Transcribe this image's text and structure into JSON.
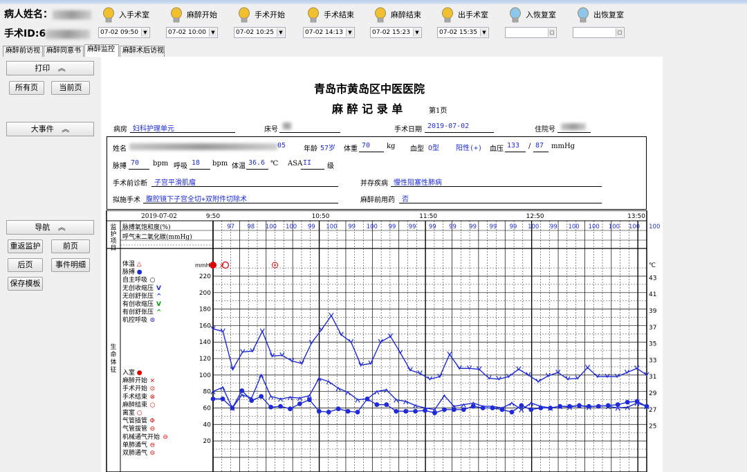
{
  "patient": {
    "name_label": "病人姓名：",
    "surgery_id_label": "手术ID:",
    "surgery_id_partial": "6"
  },
  "events": [
    {
      "label": "入手术室",
      "time": "07-02 09:50",
      "color": "#f0c030"
    },
    {
      "label": "麻醉开始",
      "time": "07-02 10:00",
      "color": "#f0c030"
    },
    {
      "label": "手术开始",
      "time": "07-02 10:25",
      "color": "#f0c030"
    },
    {
      "label": "手术结束",
      "time": "07-02 14:13",
      "color": "#f0c030"
    },
    {
      "label": "麻醉结束",
      "time": "07-02 15:23",
      "color": "#f0c030"
    },
    {
      "label": "出手术室",
      "time": "07-02 15:35",
      "color": "#f0c030"
    },
    {
      "label": "入恢复室",
      "time": "",
      "color": "#8fc6ec"
    },
    {
      "label": "出恢复室",
      "time": "",
      "color": "#8fc6ec"
    }
  ],
  "tabs": [
    "麻醉前访视",
    "麻醉同意书",
    "麻醉监控",
    "麻醉术后访视"
  ],
  "active_tab": "麻醉监控",
  "sidebar": {
    "print_header": "打印",
    "print_all": "所有页",
    "print_current": "当前页",
    "events_header": "大事件",
    "nav_header": "导航",
    "nav_buttons": [
      "重返监护",
      "前页",
      "后页",
      "事件明细",
      "保存模板"
    ],
    "chevron": "︽"
  },
  "record": {
    "hospital": "青岛市黄岛区中医医院",
    "title": "麻 醉 记 录 单",
    "page": "第1页",
    "ward_label": "病房",
    "ward": "妇科护理单元",
    "bed_label": "床号",
    "surgery_date_label": "手术日期",
    "surgery_date": "2019-07-02",
    "admission_label": "住院号",
    "name_label": "姓名",
    "id_tail": "05",
    "age_label": "年龄",
    "age": "57岁",
    "weight_label": "体重",
    "weight": "70",
    "weight_unit": "kg",
    "blood_type_label": "血型",
    "blood_type": "O型",
    "rh": "阳性(+)",
    "bp_label": "血压",
    "bp_sys": "133",
    "bp_sep": "/",
    "bp_dia": "87",
    "bp_unit": "mmHg",
    "pulse_label": "脉搏",
    "pulse": "70",
    "pulse_unit": "bpm",
    "resp_label": "呼吸",
    "resp": "18",
    "resp_unit": "bpm",
    "temp_label": "体温",
    "temp": "36.6",
    "temp_unit": "℃",
    "asa_label": "ASA",
    "asa": "II",
    "asa_unit": "级",
    "pre_diag_label": "手术前诊断",
    "pre_diag": "子宫平滑肌瘤",
    "comorbid_label": "并存疾病",
    "comorbid": "慢性阻塞性肺病",
    "planned_label": "拟施手术",
    "planned": "腹腔镜下子宫全切+双附件切除术",
    "premed_label": "麻醉前用药",
    "premed": "否"
  },
  "chart_data": {
    "type": "line",
    "date": "2019-07-02",
    "time_labels": [
      "9:50",
      "10:50",
      "11:50",
      "12:50",
      "13:50"
    ],
    "monitor_section_label": "监护项目",
    "vitals_section_label": "生命体征",
    "monitor_rows": [
      "脉搏氧饱和度(%)",
      "呼气末二氧化碳(mmHg)"
    ],
    "spo2_values": [
      "97",
      "98",
      "100",
      "100",
      "99",
      "100",
      "99",
      "100",
      "99",
      "99",
      "99",
      "99",
      "99",
      "99",
      "99",
      "100",
      "99",
      "100",
      "100",
      "100",
      "100",
      "100"
    ],
    "left_axis_unit": "mmHg",
    "left_ticks": [
      220,
      200,
      180,
      160,
      140,
      120,
      100,
      80,
      60,
      40,
      20
    ],
    "right_axis_unit": "℃",
    "right_ticks": [
      43,
      41,
      39,
      37,
      35,
      33,
      31,
      29,
      27,
      25
    ],
    "legend": [
      {
        "label": "体温",
        "symbol": "△",
        "color": "#e00000"
      },
      {
        "label": "脉搏",
        "symbol": "●",
        "color": "#1e2bd6"
      },
      {
        "label": "自主呼吸",
        "symbol": "○",
        "color": "#000000"
      },
      {
        "label": "无创收缩压",
        "symbol": "V",
        "color": "#1e2bd6"
      },
      {
        "label": "无创舒张压",
        "symbol": "^",
        "color": "#1e2bd6"
      },
      {
        "label": "有创收缩压",
        "symbol": "V",
        "color": "#00a000"
      },
      {
        "label": "有创舒张压",
        "symbol": "^",
        "color": "#00a000"
      },
      {
        "label": "机控呼吸",
        "symbol": "⊙",
        "color": "#1e2bd6"
      }
    ],
    "event_legend": [
      {
        "label": "入室",
        "symbol": "●",
        "color": "#e00000"
      },
      {
        "label": "麻醉开始",
        "symbol": "×",
        "color": "#e00000"
      },
      {
        "label": "手术开始",
        "symbol": "⊙",
        "color": "#e00000"
      },
      {
        "label": "手术结束",
        "symbol": "⊗",
        "color": "#e00000"
      },
      {
        "label": "麻醉结束",
        "symbol": "○",
        "color": "#e00000"
      },
      {
        "label": "离室",
        "symbol": "○",
        "color": "#e00000"
      },
      {
        "label": "气管插管",
        "symbol": "Φ",
        "color": "#e00000"
      },
      {
        "label": "气管拔管",
        "symbol": "⊖",
        "color": "#e00000"
      },
      {
        "label": "机械通气开始",
        "symbol": "⊖",
        "color": "#e00000"
      },
      {
        "label": "单肺通气",
        "symbol": "⊖",
        "color": "#e00000"
      },
      {
        "label": "双肺通气",
        "symbol": "⊖",
        "color": "#e00000"
      }
    ],
    "x_minutes": [
      0,
      5,
      10,
      15,
      20,
      25,
      30,
      35,
      40,
      45,
      50,
      55,
      60,
      65,
      70,
      75,
      80,
      85,
      90,
      95,
      100,
      105,
      110,
      115,
      120,
      125,
      130,
      135,
      140,
      145,
      150,
      155,
      160,
      165,
      170,
      175,
      180,
      185,
      190,
      195,
      200,
      205,
      210,
      215,
      220,
      225,
      230,
      235,
      240,
      245
    ],
    "series": [
      {
        "name": "无创收缩压",
        "color": "#1e2bd6",
        "values": [
          156,
          153,
          107,
          128,
          129,
          153,
          123,
          124,
          117,
          114,
          139,
          155,
          172,
          149,
          140,
          112,
          114,
          140,
          147,
          127,
          106,
          102,
          95,
          98,
          125,
          108,
          108,
          107,
          96,
          95,
          98,
          107,
          100,
          92,
          99,
          103,
          95,
          96,
          109,
          98,
          98,
          98,
          103,
          108,
          100
        ]
      },
      {
        "name": "无创舒张压",
        "color": "#1e2bd6",
        "values": [
          80,
          85,
          60,
          76,
          72,
          100,
          74,
          71,
          73,
          72,
          75,
          96,
          92,
          84,
          79,
          70,
          71,
          80,
          82,
          70,
          68,
          63,
          60,
          58,
          75,
          62,
          64,
          66,
          62,
          62,
          60,
          66,
          58,
          66,
          62,
          60,
          62,
          61,
          63,
          61,
          63,
          62,
          60,
          61,
          66,
          62
        ]
      },
      {
        "name": "脉搏",
        "color": "#1e2bd6",
        "values": [
          71,
          71,
          60,
          81,
          69,
          74,
          61,
          62,
          59,
          65,
          70,
          56,
          55,
          59,
          56,
          55,
          71,
          64,
          64,
          56,
          56,
          56,
          57,
          54,
          58,
          58,
          58,
          62,
          60,
          60,
          58,
          55,
          63,
          58,
          60,
          60,
          62,
          62,
          63,
          62,
          62,
          63,
          64,
          67,
          68,
          62
        ]
      }
    ]
  }
}
